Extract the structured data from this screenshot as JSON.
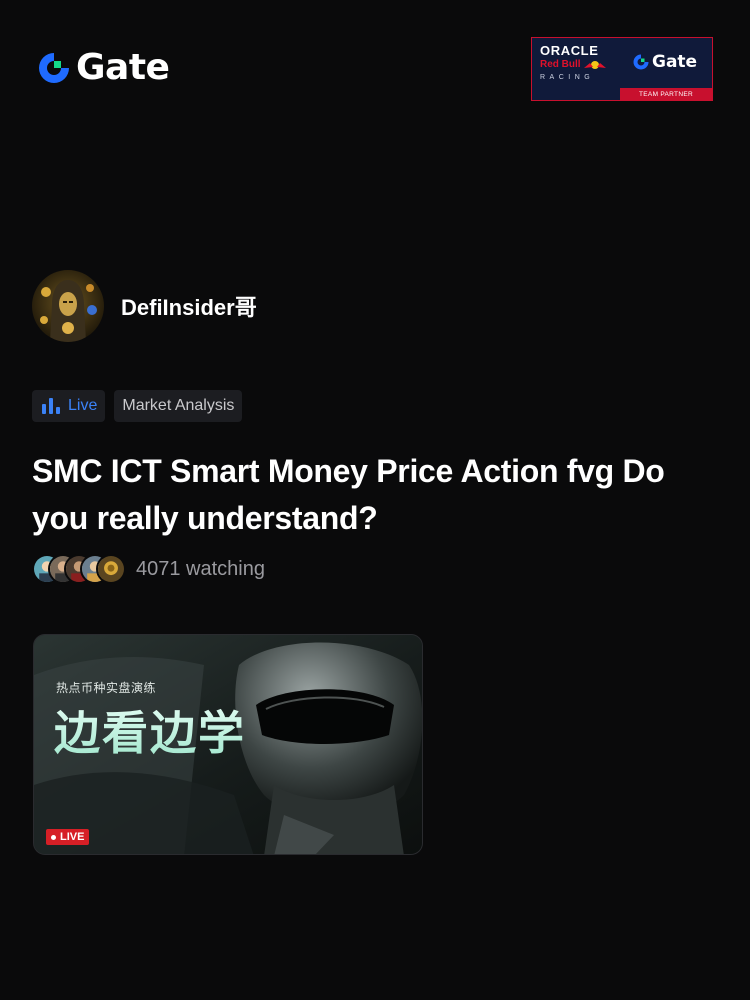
{
  "header": {
    "logo_text": "Gate",
    "brand_color": "#1f6bff",
    "accent_color": "#14d98a",
    "partner": {
      "line1": "ORACLE",
      "line2": "Red Bull",
      "line3": "RACING",
      "gate_text": "Gate",
      "badge": "TEAM PARTNER"
    }
  },
  "author": {
    "name": "DefiInsider哥",
    "avatar_icon": "hooded-figure-avatar"
  },
  "tags": {
    "live_label": "Live",
    "live_icon": "bar-chart-icon",
    "category": "Market Analysis"
  },
  "stream": {
    "title": "SMC ICT Smart Money Price Action fvg Do you really understand?",
    "watching_text": "4071 watching",
    "viewer_avatars": [
      "viewer-1",
      "viewer-2",
      "viewer-3",
      "viewer-4",
      "viewer-5"
    ]
  },
  "thumbnail": {
    "subtitle": "热点币种实盘演练",
    "headline": "边看边学",
    "live_badge": "LIVE"
  },
  "colors": {
    "background": "#0a0a0b",
    "live_blue": "#3b82f6",
    "live_red": "#d61f26",
    "muted_text": "#9a9a9f"
  }
}
